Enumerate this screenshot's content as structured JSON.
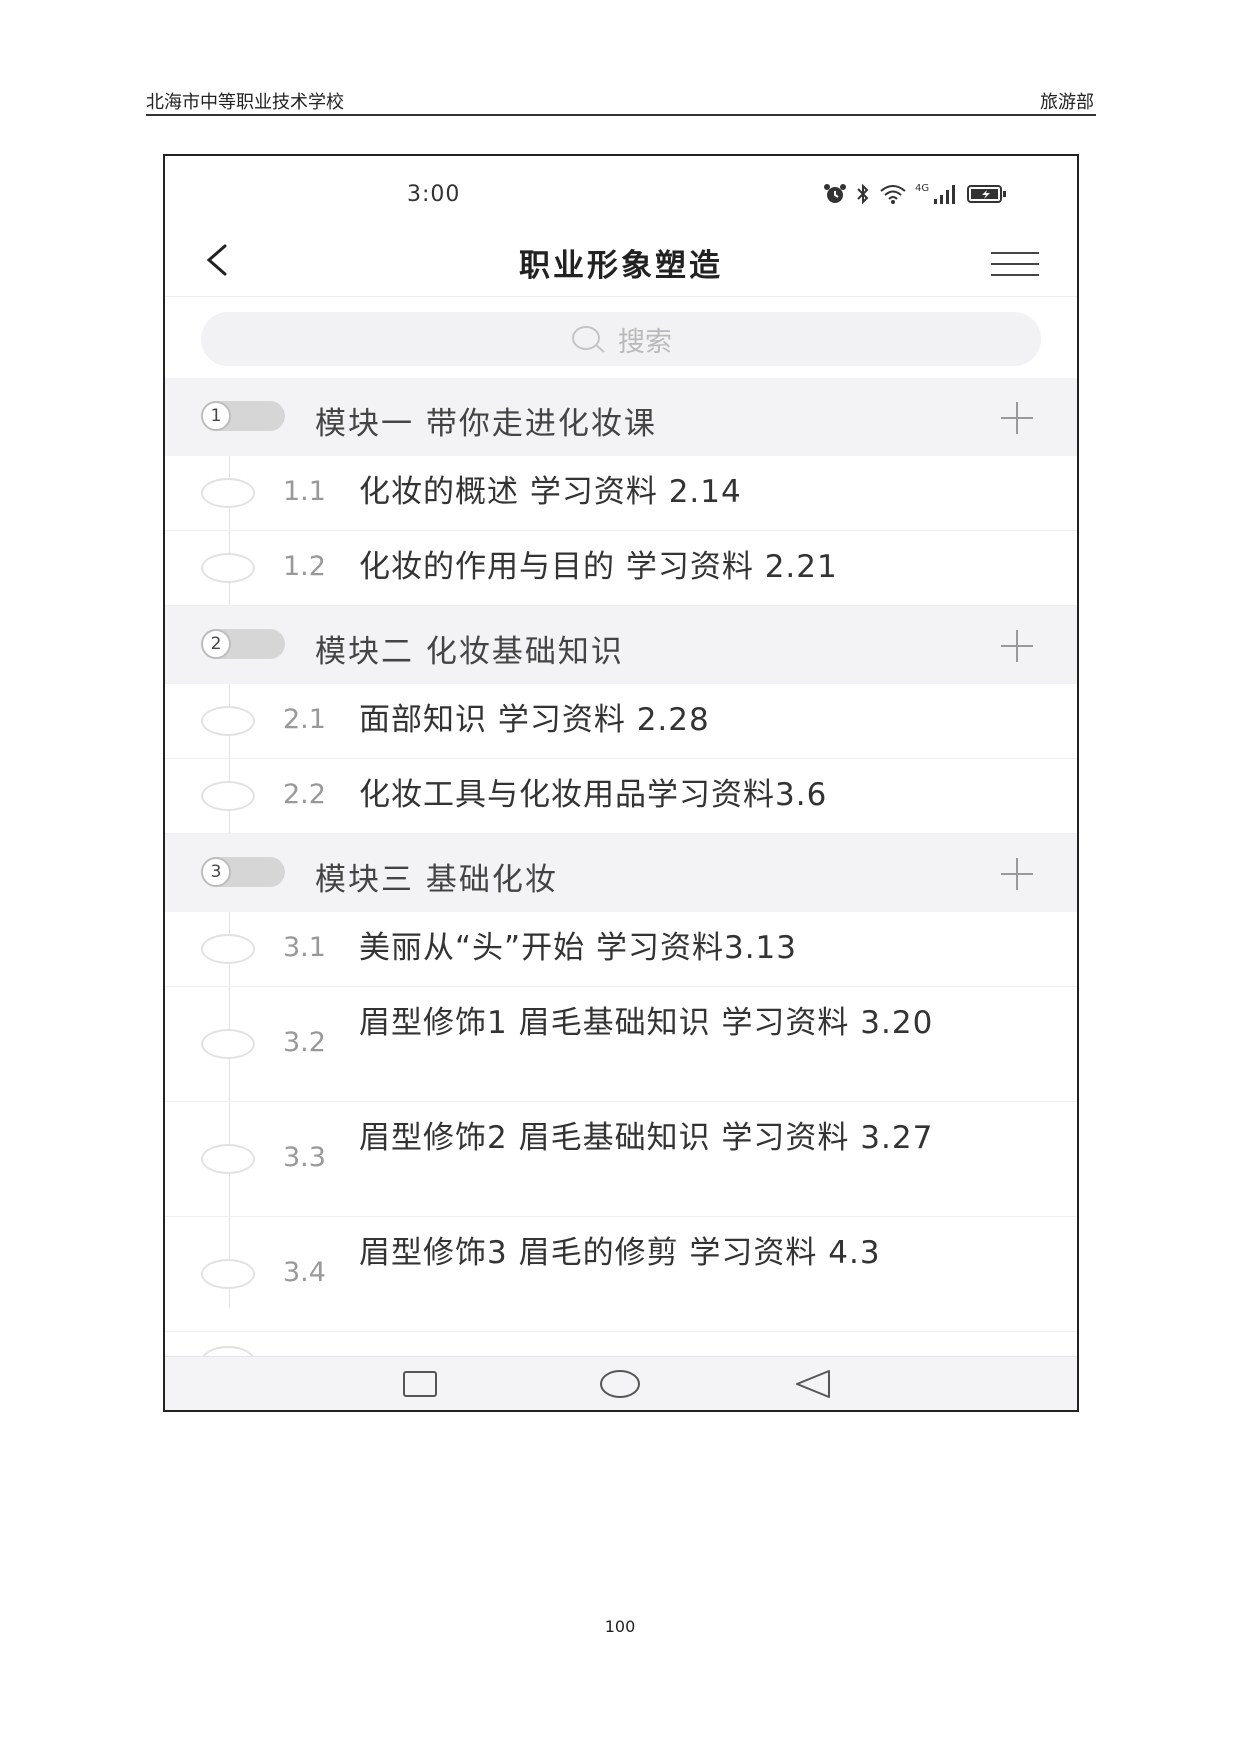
{
  "doc_header": {
    "left": "北海市中等职业技术学校",
    "right": "旅游部"
  },
  "status_bar": {
    "time": "3:00",
    "network": "4G"
  },
  "nav": {
    "title": "职业形象塑造"
  },
  "search": {
    "placeholder": "搜索"
  },
  "modules": [
    {
      "number": "1",
      "title": "模块一 带你走进化妆课",
      "lessons": [
        {
          "number": "1.1",
          "title": "化妆的概述 学习资料 2.14"
        },
        {
          "number": "1.2",
          "title": "化妆的作用与目的 学习资料 2.21"
        }
      ]
    },
    {
      "number": "2",
      "title": "模块二 化妆基础知识",
      "lessons": [
        {
          "number": "2.1",
          "title": "面部知识 学习资料 2.28"
        },
        {
          "number": "2.2",
          "title": "化妆工具与化妆用品学习资料3.6"
        }
      ]
    },
    {
      "number": "3",
      "title": "模块三 基础化妆",
      "lessons": [
        {
          "number": "3.1",
          "title": "美丽从“头”开始 学习资料3.13"
        },
        {
          "number": "3.2",
          "title": "眉型修饰1 眉毛基础知识 学习资料 3.20"
        },
        {
          "number": "3.3",
          "title": "眉型修饰2 眉毛基础知识 学习资料 3.27"
        },
        {
          "number": "3.4",
          "title": "眉型修饰3 眉毛的修剪 学习资料 4.3"
        }
      ]
    }
  ],
  "page_number": "100"
}
